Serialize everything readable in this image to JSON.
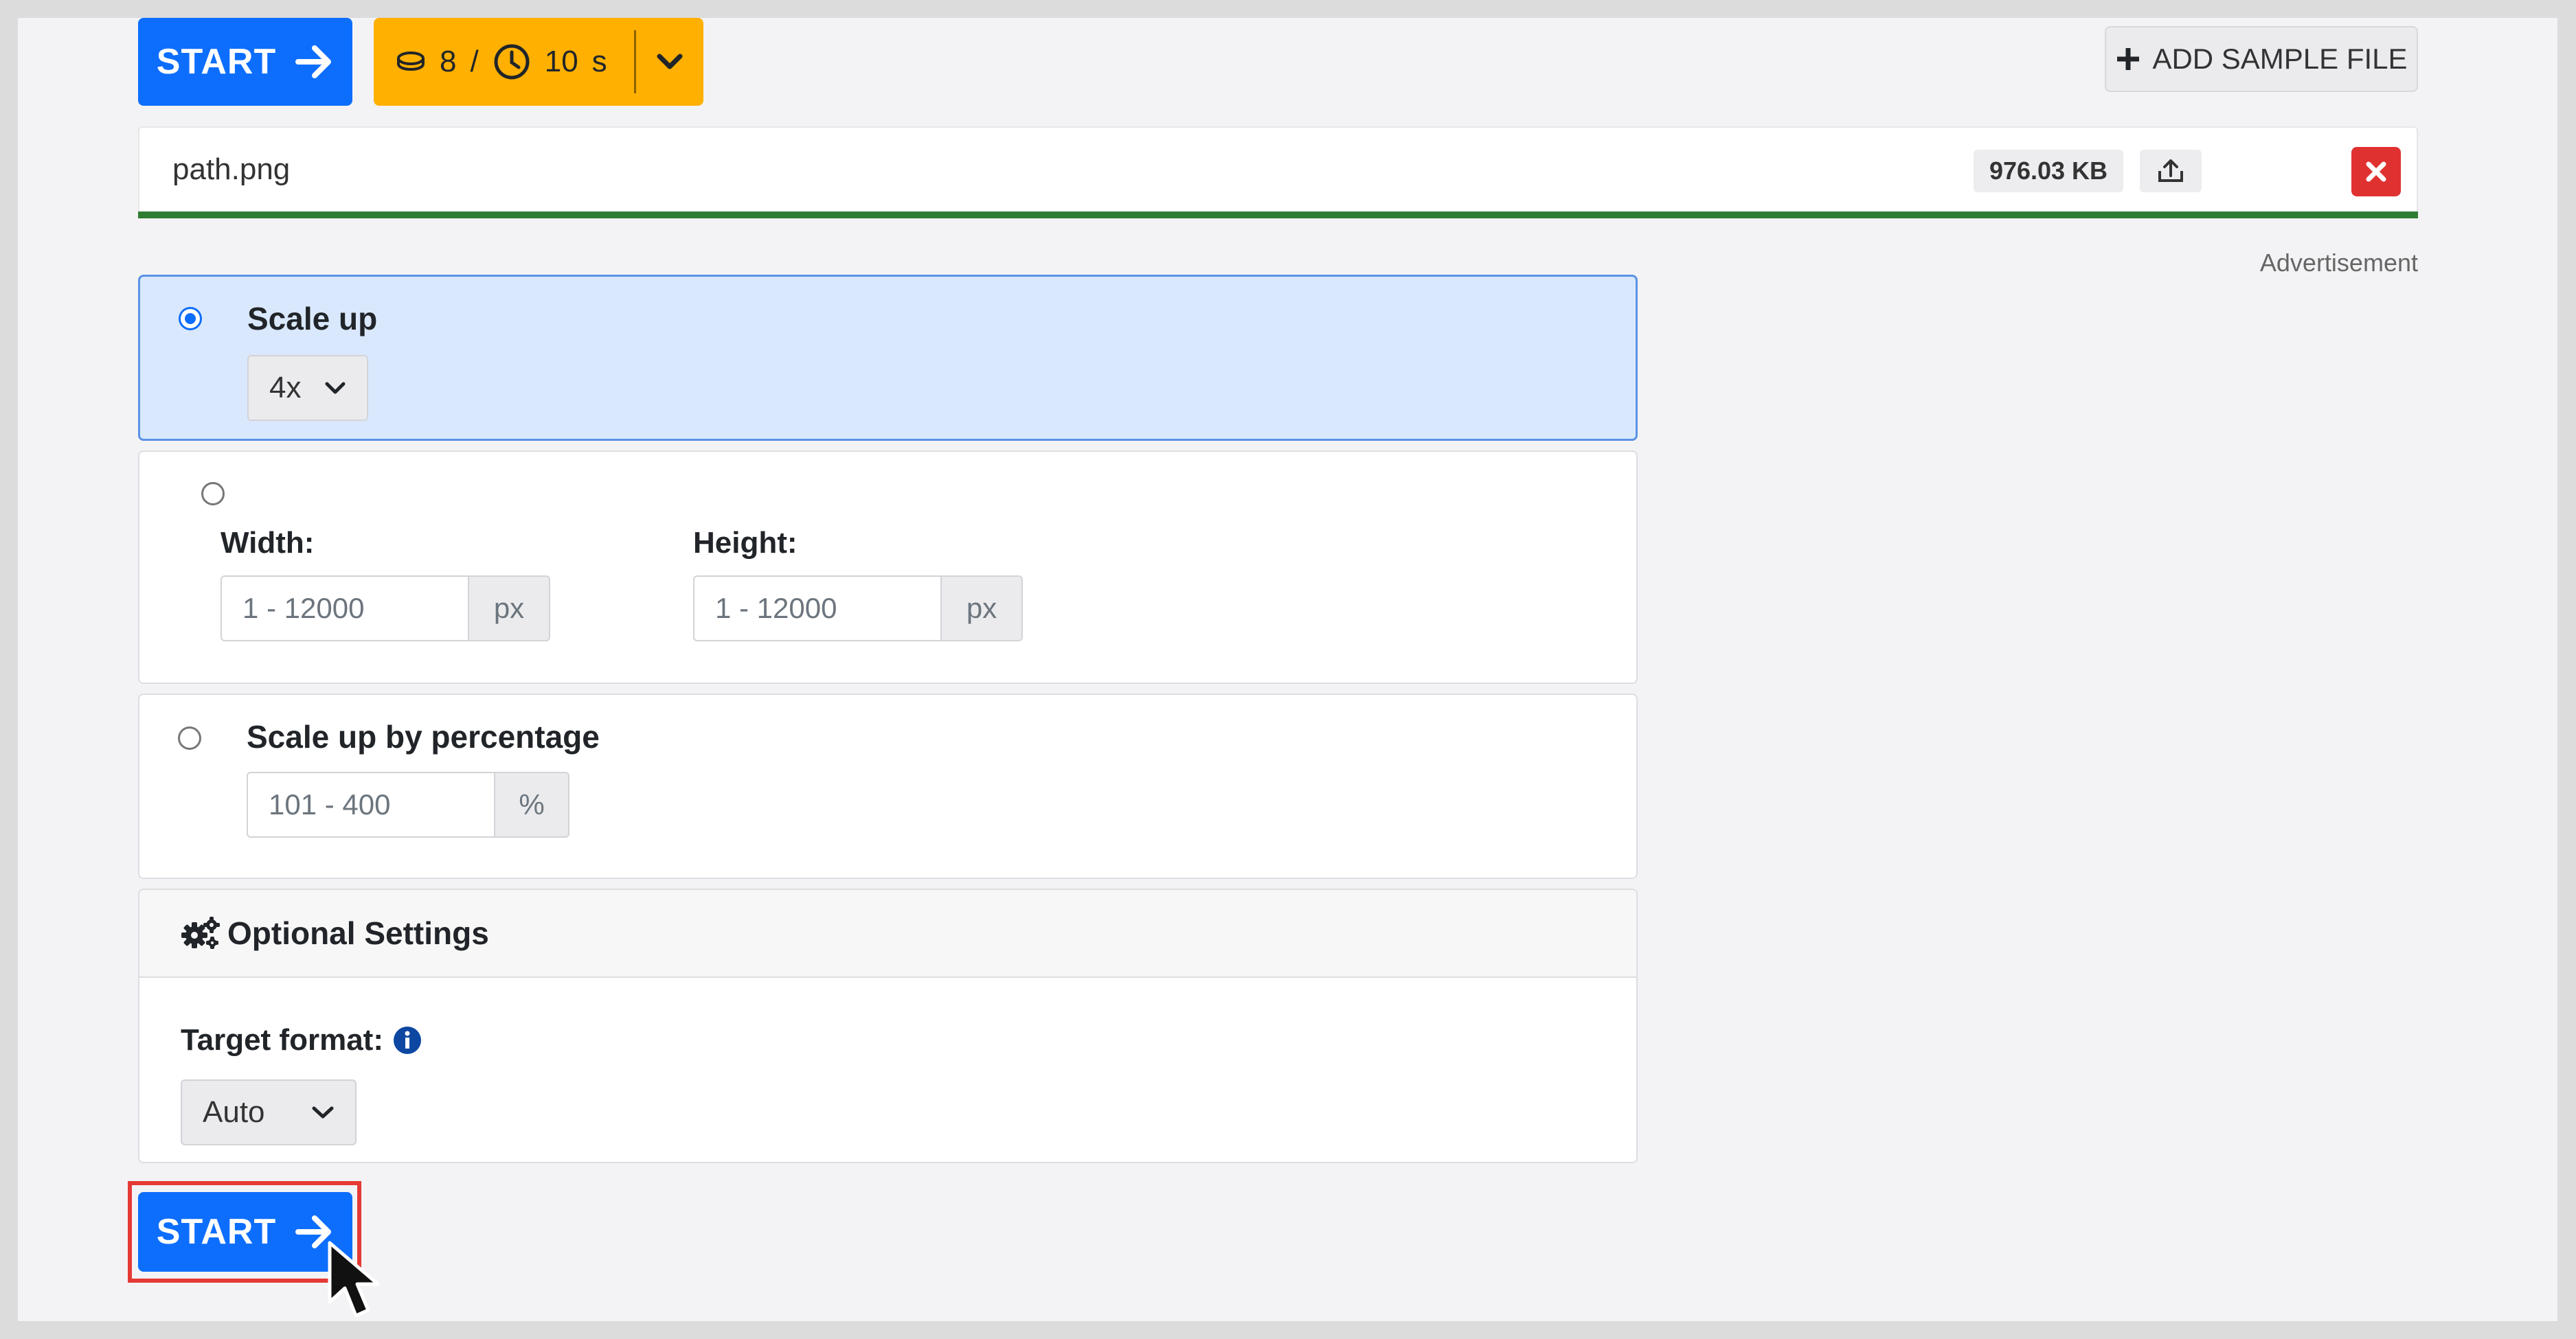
{
  "toolbar": {
    "start_label": "START",
    "credits": "8",
    "credits_sep": "/",
    "time": "10",
    "time_unit": "s",
    "add_sample_label": "ADD SAMPLE FILE"
  },
  "file": {
    "name": "path.png",
    "size": "976.03 KB",
    "upload_progress": 1.0
  },
  "advertisement_label": "Advertisement",
  "options": {
    "scale_up": {
      "label": "Scale up",
      "selected": true,
      "factor": "4x"
    },
    "dimensions": {
      "selected": false,
      "width_label": "Width:",
      "width_placeholder": "1 - 12000",
      "width_unit": "px",
      "height_label": "Height:",
      "height_placeholder": "1 - 12000",
      "height_unit": "px"
    },
    "percentage": {
      "selected": false,
      "label": "Scale up by percentage",
      "placeholder": "101 - 400",
      "unit": "%"
    }
  },
  "optional_settings": {
    "title": "Optional Settings",
    "target_format_label": "Target format:",
    "target_format_value": "Auto"
  },
  "bottom": {
    "start_label": "START"
  },
  "colors": {
    "primary": "#0d6efd",
    "credits": "#ffb000",
    "danger": "#e03131",
    "progress": "#2e7d32",
    "highlight": "#e53935"
  }
}
